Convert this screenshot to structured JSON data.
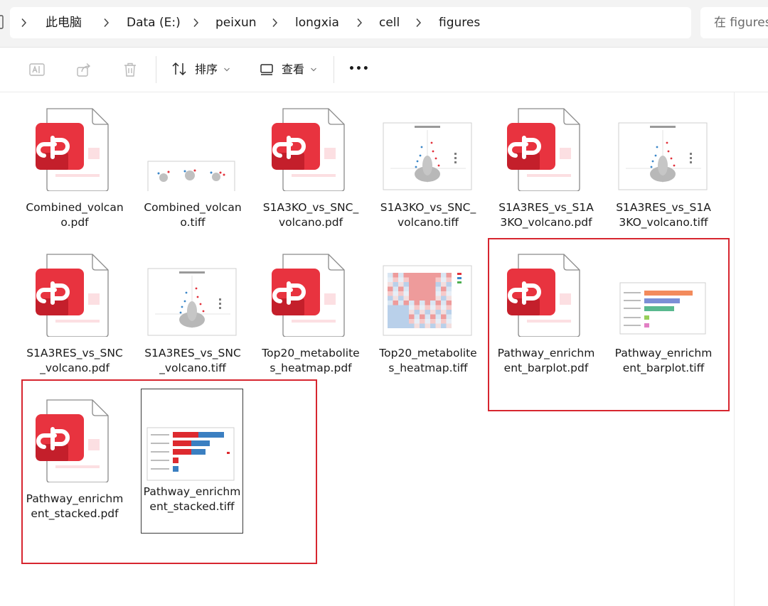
{
  "breadcrumb": {
    "items": [
      "此电脑",
      "Data (E:)",
      "peixun",
      "longxia",
      "cell",
      "figures"
    ]
  },
  "search": {
    "placeholder": "在 figures 中搜索"
  },
  "toolbar": {
    "sort_label": "排序",
    "view_label": "查看",
    "more_label": "•••",
    "icons": [
      "rename-icon",
      "share-icon",
      "delete-icon",
      "sort-icon",
      "view-icon",
      "more-icon"
    ]
  },
  "colors": {
    "pdf_red": "#e8333f",
    "selection_highlight": "#d7262f",
    "volcano_up": "#e2303a",
    "volcano_down": "#3a86c8",
    "volcano_ns": "#b8b8b8",
    "stacked_red": "#dd2a2f",
    "stacked_blue": "#3a7fc1"
  },
  "files": [
    {
      "name": "Combined_volcano.pdf",
      "type": "pdf"
    },
    {
      "name": "Combined_volcano.tiff",
      "type": "tiff"
    },
    {
      "name": "S1A3KO_vs_SNC_volcano.pdf",
      "type": "pdf"
    },
    {
      "name": "S1A3KO_vs_SNC_volcano.tiff",
      "type": "tiff"
    },
    {
      "name": "S1A3RES_vs_S1A3KO_volcano.pdf",
      "type": "pdf"
    },
    {
      "name": "S1A3RES_vs_S1A3KO_volcano.tiff",
      "type": "tiff"
    },
    {
      "name": "S1A3RES_vs_SNC_volcano.pdf",
      "type": "pdf"
    },
    {
      "name": "S1A3RES_vs_SNC_volcano.tiff",
      "type": "tiff"
    },
    {
      "name": "Top20_metabolites_heatmap.pdf",
      "type": "pdf"
    },
    {
      "name": "Top20_metabolites_heatmap.tiff",
      "type": "tiff"
    },
    {
      "name": "Pathway_enrichment_barplot.pdf",
      "type": "pdf"
    },
    {
      "name": "Pathway_enrichment_barplot.tiff",
      "type": "tiff"
    },
    {
      "name": "Pathway_enrichment_stacked.pdf",
      "type": "pdf"
    },
    {
      "name": "Pathway_enrichment_stacked.tiff",
      "type": "tiff",
      "selected": true
    }
  ]
}
